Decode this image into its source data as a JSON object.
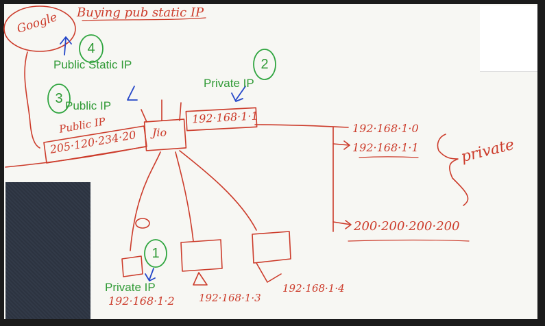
{
  "labels": {
    "public_static_ip": "Public Static IP",
    "private_ip_router": "Private IP",
    "public_ip": "Public IP",
    "private_ip_device": "Private IP"
  },
  "numbers": {
    "n1": "1",
    "n2": "2",
    "n3": "3",
    "n4": "4"
  },
  "handwriting": {
    "google": "Google",
    "top_note": "Buying pub static IP",
    "public_ip_note": "Public IP",
    "public_ip_value": "205·120·234·20",
    "router": "Jio",
    "router_lan_ip": "192·168·1·1",
    "net_private_1": "192·168·1·0",
    "net_private_2": "192·168·1·1",
    "private_word": "private",
    "net_public": "200·200·200·200",
    "device1_ip": "192·168·1·2",
    "device2_ip": "192·168·1·3",
    "device3_ip": "192·168·1·4"
  }
}
